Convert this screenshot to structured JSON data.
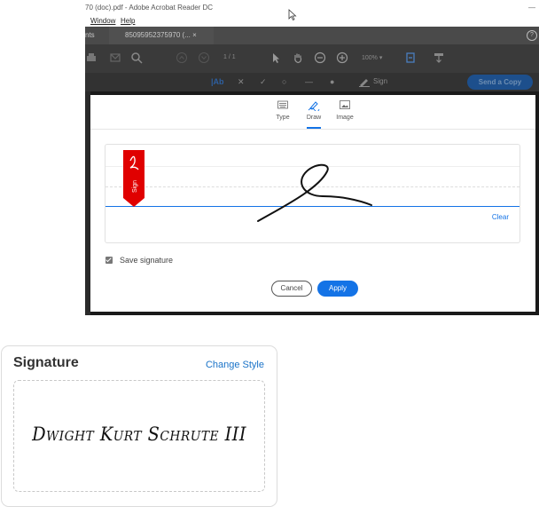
{
  "window": {
    "title": "70 (doc).pdf - Adobe Acrobat Reader DC",
    "min_glyph": "—"
  },
  "menu": {
    "window_label": "Window",
    "help_label": "Help"
  },
  "tabs": {
    "partial_left": "nts",
    "doc_tab": "85095952375970 (... ×",
    "help_glyph": "?"
  },
  "toolbar": {
    "pages": "1 / 1",
    "zoom": "100%  ▾"
  },
  "signbar": {
    "text_tool": "|Ab",
    "sign_label": "Sign",
    "send_copy": "Send a Copy"
  },
  "dialog": {
    "modes": [
      {
        "label": "Type"
      },
      {
        "label": "Draw"
      },
      {
        "label": "Image"
      }
    ],
    "active_mode": "Draw",
    "ribbon_text": "Sign",
    "clear_label": "Clear",
    "save_label": "Save signature",
    "save_checked": true,
    "cancel_label": "Cancel",
    "apply_label": "Apply"
  },
  "signature_card": {
    "heading": "Signature",
    "change_style": "Change Style",
    "signature_text": "Dwight Kurt Schrute III"
  },
  "colors": {
    "accent": "#1473e6",
    "ribbon": "#e00000",
    "link": "#1a73c8"
  }
}
